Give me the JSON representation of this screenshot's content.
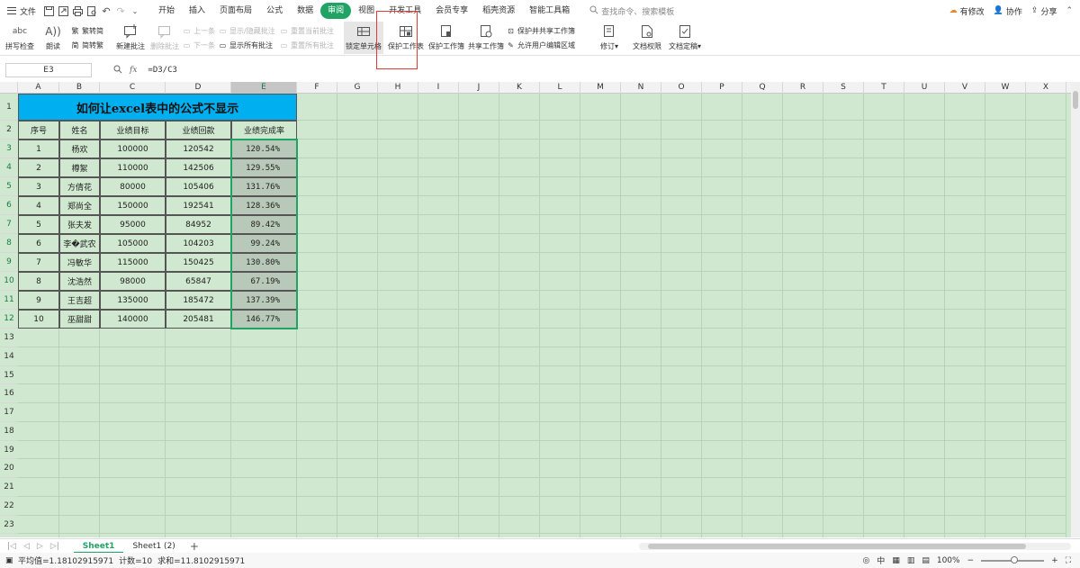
{
  "menubar": {
    "file": "文件",
    "tabs": [
      "开始",
      "插入",
      "页面布局",
      "公式",
      "数据",
      "审阅",
      "视图",
      "开发工具",
      "会员专享",
      "稻壳资源",
      "智能工具箱"
    ],
    "active_tab": "审阅",
    "search": "查找命令、搜索模板",
    "right": {
      "changes": "有修改",
      "collab": "协作",
      "share": "分享"
    }
  },
  "ribbon": {
    "spell": "拼写检查",
    "read": "朗读",
    "trad_simp": "繁转简",
    "simp_trad": "简转繁",
    "new_comment": "新建批注",
    "delete_comment": "删除批注",
    "prev": "上一条",
    "next": "下一条",
    "show_hide_comment": "显示/隐藏批注",
    "show_all_comments": "显示所有批注",
    "reset_current": "重置当前批注",
    "reset_all": "重置所有批注",
    "lock_cell": "锁定单元格",
    "protect_sheet": "保护工作表",
    "protect_workbook": "保护工作簿",
    "share_workbook": "共享工作簿",
    "protect_shared": "保护并共享工作簿",
    "allow_edit": "允许用户编辑区域",
    "revise": "修订",
    "doc_rights": "文档权限",
    "doc_final": "文档定稿"
  },
  "formula_bar": {
    "name_box": "E3",
    "formula": "=D3/C3",
    "fx": "fx"
  },
  "columns": [
    "A",
    "B",
    "C",
    "D",
    "E",
    "F",
    "G",
    "H",
    "I",
    "J",
    "K",
    "L",
    "M",
    "N",
    "O",
    "P",
    "Q",
    "R",
    "S",
    "T",
    "U",
    "V",
    "W",
    "X"
  ],
  "row_numbers": [
    "1",
    "2",
    "3",
    "4",
    "5",
    "6",
    "7",
    "8",
    "9",
    "10",
    "11",
    "12",
    "13",
    "14",
    "15",
    "16",
    "17",
    "18",
    "19",
    "20",
    "21",
    "22",
    "23"
  ],
  "sheet": {
    "title": "如何让excel表中的公式不显示",
    "headers": [
      "序号",
      "姓名",
      "业绩目标",
      "业绩回款",
      "业绩完成率"
    ],
    "rows": [
      [
        "1",
        "杨欢",
        "100000",
        "120542",
        "120.54%"
      ],
      [
        "2",
        "樽絮",
        "110000",
        "142506",
        "129.55%"
      ],
      [
        "3",
        "方倩花",
        "80000",
        "105406",
        "131.76%"
      ],
      [
        "4",
        "郑尚全",
        "150000",
        "192541",
        "128.36%"
      ],
      [
        "5",
        "张夫发",
        "95000",
        "84952",
        "89.42%"
      ],
      [
        "6",
        "李�武农",
        "105000",
        "104203",
        "99.24%"
      ],
      [
        "7",
        "冯敏华",
        "115000",
        "150425",
        "130.80%"
      ],
      [
        "8",
        "沈浩然",
        "98000",
        "65847",
        "67.19%"
      ],
      [
        "9",
        "王吉超",
        "135000",
        "185472",
        "137.39%"
      ],
      [
        "10",
        "巫甜甜",
        "140000",
        "205481",
        "146.77%"
      ]
    ]
  },
  "sheet_tabs": [
    "Sheet1",
    "Sheet1 (2)"
  ],
  "active_sheet": "Sheet1",
  "status": {
    "average": "平均值=1.18102915971",
    "count": "计数=10",
    "sum": "求和=11.8102915971",
    "zoom": "100%"
  },
  "colors": {
    "accent": "#21a366",
    "title_bg": "#00aff0",
    "grid_bg": "#cfe8cf",
    "highlight": "#e53935"
  }
}
